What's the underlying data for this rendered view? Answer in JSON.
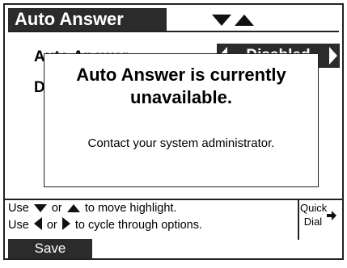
{
  "header": {
    "title": "Auto Answer"
  },
  "background_fields": {
    "row1_label": "Auto Answer",
    "row1_value": "Disabled",
    "row2_label": "D"
  },
  "dialog": {
    "title": "Auto Answer is currently unavailable.",
    "message": "Contact your system administrator."
  },
  "help": {
    "line1_use": "Use",
    "line1_or": "or",
    "line1_text": "to move highlight.",
    "line2_use": "Use",
    "line2_or": "or",
    "line2_text": "to cycle through options.",
    "quick_dial": "Quick Dial"
  },
  "softkeys": {
    "save_label": "Save"
  },
  "icons": {
    "down": "down-triangle-icon",
    "up": "up-triangle-icon",
    "left": "left-arrow-icon",
    "right": "right-arrow-icon",
    "quick": "right-arrow-icon"
  },
  "colors": {
    "dark": "#2b2b2b",
    "light": "#ffffff"
  }
}
